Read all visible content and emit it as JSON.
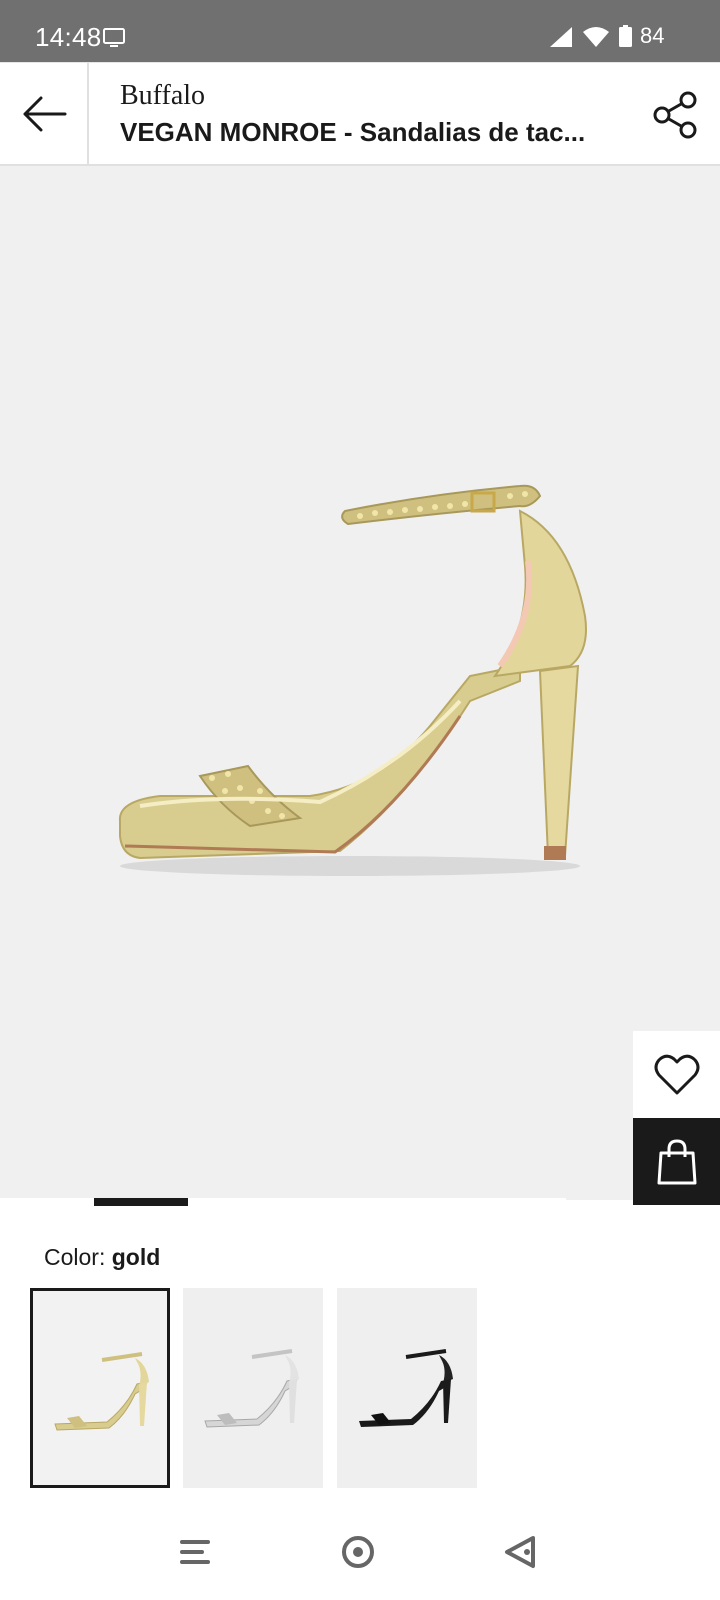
{
  "status_bar": {
    "time": "14:48",
    "battery_level": "84",
    "icons": [
      "screen-cast-icon",
      "signal-icon",
      "wifi-icon",
      "battery-icon"
    ]
  },
  "header": {
    "brand": "Buffalo",
    "title": "VEGAN MONROE - Sandalias de tac...",
    "back_icon": "arrow-left-icon",
    "share_icon": "share-icon"
  },
  "gallery": {
    "image_subject": "gold glitter high heel sandal",
    "wishlist_icon": "heart-icon",
    "bag_icon": "shopping-bag-icon",
    "current_image_index": 2,
    "image_count": 6
  },
  "color_section": {
    "label": "Color:",
    "selected": "gold",
    "swatches": [
      {
        "color": "gold",
        "selected": true
      },
      {
        "color": "silver",
        "selected": false
      },
      {
        "color": "black",
        "selected": false
      }
    ]
  },
  "nav_bar": {
    "icons": [
      "menu-icon",
      "home-icon",
      "back-triangle-icon"
    ]
  },
  "colors": {
    "status_bar_bg": "#707070",
    "gallery_bg": "#f0f0f0",
    "bag_button_bg": "#1a1a1a",
    "text_primary": "#1a1a1a"
  }
}
